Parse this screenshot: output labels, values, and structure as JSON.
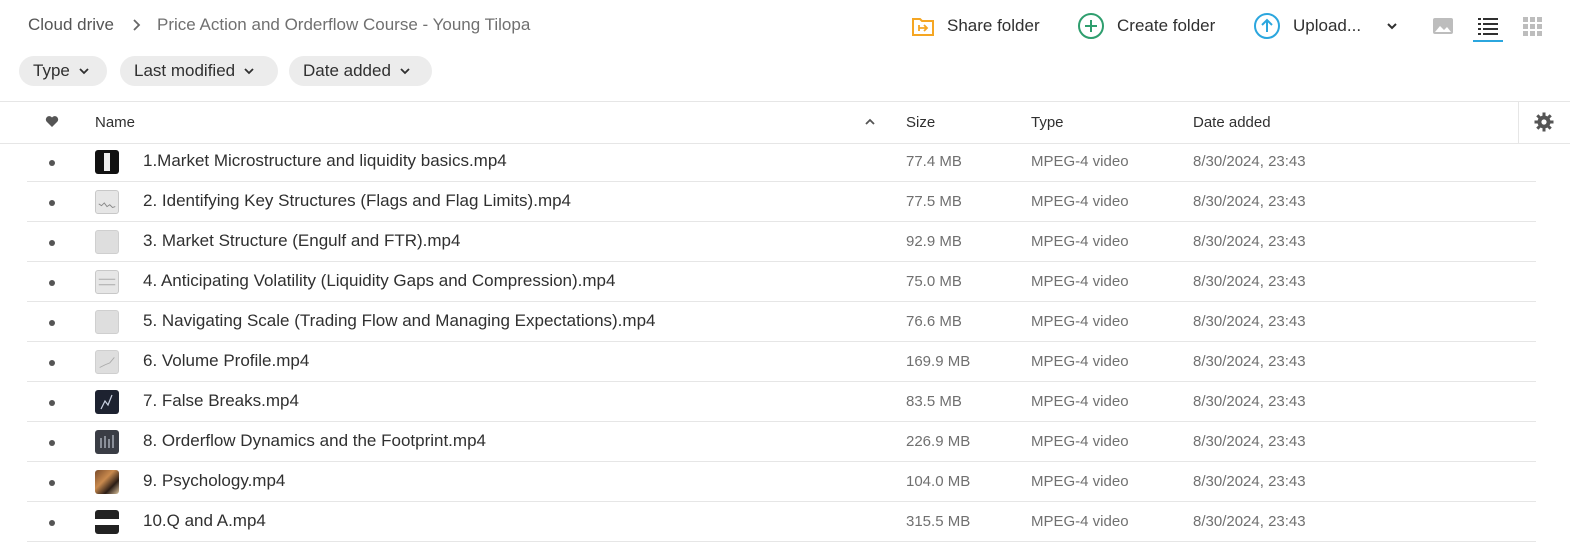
{
  "breadcrumb": {
    "root": "Cloud drive",
    "current": "Price Action and Orderflow Course - Young Tilopa"
  },
  "actions": {
    "share": "Share folder",
    "create": "Create folder",
    "upload": "Upload..."
  },
  "filters": {
    "type": "Type",
    "last_modified": "Last modified",
    "date_added": "Date added"
  },
  "columns": {
    "name": "Name",
    "size": "Size",
    "type": "Type",
    "date_added": "Date added"
  },
  "colors": {
    "accent": "#2ba6de",
    "share_icon": "#f5a623",
    "create_icon": "#2e9e6e",
    "upload_icon": "#2ba6de"
  },
  "files": [
    {
      "name": "1.Market Microstructure and liquidity basics.mp4",
      "size": "77.4 MB",
      "type": "MPEG-4 video",
      "date": "8/30/2024, 23:43",
      "thumb": "dark"
    },
    {
      "name": "2. Identifying Key Structures (Flags and Flag Limits).mp4",
      "size": "77.5 MB",
      "type": "MPEG-4 video",
      "date": "8/30/2024, 23:43",
      "thumb": "chart"
    },
    {
      "name": "3. Market Structure (Engulf and FTR).mp4",
      "size": "92.9 MB",
      "type": "MPEG-4 video",
      "date": "8/30/2024, 23:43",
      "thumb": "light"
    },
    {
      "name": "4. Anticipating Volatility (Liquidity Gaps and Compression).mp4",
      "size": "75.0 MB",
      "type": "MPEG-4 video",
      "date": "8/30/2024, 23:43",
      "thumb": "chart"
    },
    {
      "name": "5. Navigating Scale (Trading Flow and Managing Expectations).mp4",
      "size": "76.6 MB",
      "type": "MPEG-4 video",
      "date": "8/30/2024, 23:43",
      "thumb": "light"
    },
    {
      "name": "6. Volume Profile.mp4",
      "size": "169.9 MB",
      "type": "MPEG-4 video",
      "date": "8/30/2024, 23:43",
      "thumb": "light"
    },
    {
      "name": "7. False Breaks.mp4",
      "size": "83.5 MB",
      "type": "MPEG-4 video",
      "date": "8/30/2024, 23:43",
      "thumb": "navy"
    },
    {
      "name": "8. Orderflow Dynamics and the Footprint.mp4",
      "size": "226.9 MB",
      "type": "MPEG-4 video",
      "date": "8/30/2024, 23:43",
      "thumb": "gray"
    },
    {
      "name": "9. Psychology.mp4",
      "size": "104.0 MB",
      "type": "MPEG-4 video",
      "date": "8/30/2024, 23:43",
      "thumb": "photo"
    },
    {
      "name": "10.Q and A.mp4",
      "size": "315.5 MB",
      "type": "MPEG-4 video",
      "date": "8/30/2024, 23:43",
      "thumb": "band"
    }
  ]
}
